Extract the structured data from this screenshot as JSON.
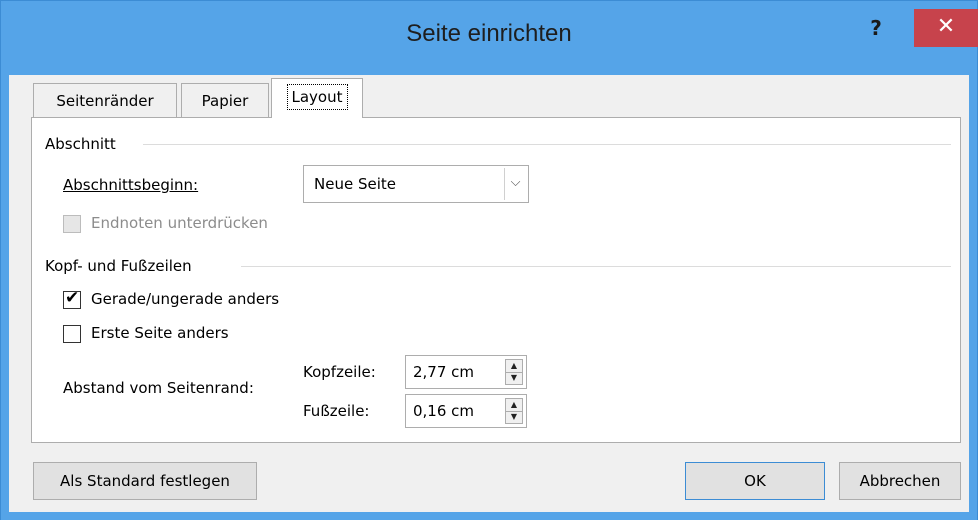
{
  "window": {
    "title": "Seite einrichten",
    "help_label": "?",
    "close_label": "✕",
    "accent_color": "#55a4e8",
    "close_color": "#c7434c"
  },
  "tabs": [
    {
      "label": "Seitenränder",
      "active": false
    },
    {
      "label": "Papier",
      "active": false
    },
    {
      "label": "Layout",
      "active": true
    }
  ],
  "section": {
    "group_label": "Abschnitt",
    "start_label": "Abschnittsbeginn:",
    "start_value": "Neue Seite",
    "endnotes_label": "Endnoten unterdrücken",
    "endnotes_checked": false,
    "endnotes_disabled": true
  },
  "headers_footers": {
    "group_label": "Kopf- und Fußzeilen",
    "odd_even_label": "Gerade/ungerade anders",
    "odd_even_checked": true,
    "first_page_label": "Erste Seite anders",
    "first_page_checked": false,
    "distance_label": "Abstand vom Seitenrand:",
    "header_label": "Kopfzeile:",
    "header_value": "2,77 cm",
    "footer_label": "Fußzeile:",
    "footer_value": "0,16 cm"
  },
  "footer": {
    "default_button": "Als Standard festlegen",
    "ok_button": "OK",
    "cancel_button": "Abbrechen"
  }
}
